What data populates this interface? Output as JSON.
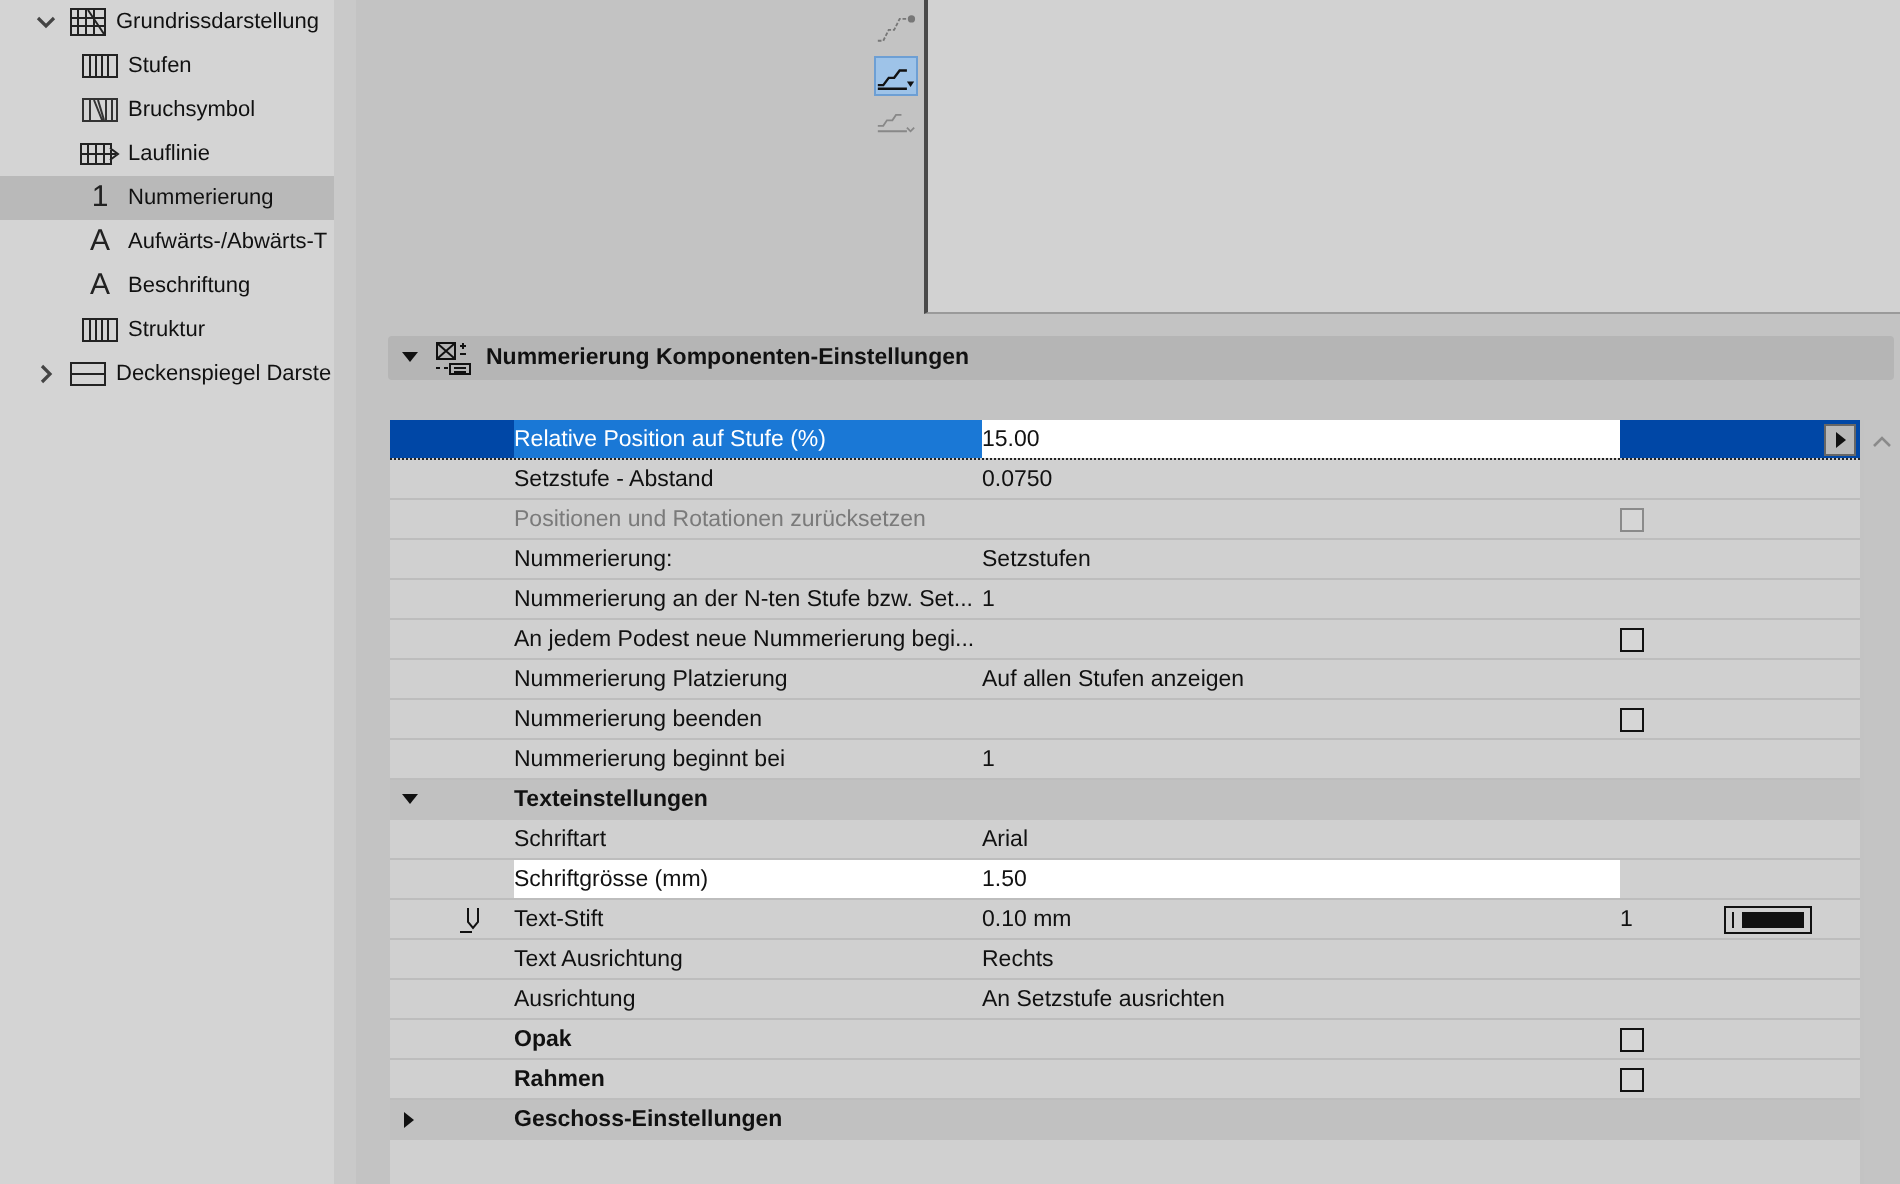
{
  "sidebar": {
    "items": [
      {
        "label": "Grundrissdarstellung",
        "kind": "plan",
        "expanded": true,
        "selected": false,
        "children": [
          {
            "label": "Stufen",
            "kind": "treads",
            "selected": false
          },
          {
            "label": "Bruchsymbol",
            "kind": "break",
            "selected": false
          },
          {
            "label": "Lauflinie",
            "kind": "walkline",
            "selected": false
          },
          {
            "label": "Nummerierung",
            "kind": "glyph",
            "glyph": "1",
            "selected": true
          },
          {
            "label": "Aufwärts-/Abwärts-T",
            "kind": "glyph",
            "glyph": "A",
            "selected": false
          },
          {
            "label": "Beschriftung",
            "kind": "glyph",
            "glyph": "A",
            "selected": false
          },
          {
            "label": "Struktur",
            "kind": "treads",
            "selected": false
          }
        ]
      },
      {
        "label": "Deckenspiegel Darste",
        "kind": "ceiling",
        "expanded": false,
        "selected": false
      }
    ]
  },
  "profile_buttons": [
    {
      "selected": false
    },
    {
      "selected": true
    },
    {
      "selected": false
    }
  ],
  "section": {
    "title": "Nummerierung Komponenten-Einstellungen",
    "expanded": true
  },
  "rows": [
    {
      "kind": "value",
      "label": "Relative Position auf Stufe (%)",
      "value": "15.00",
      "selected": true,
      "highlighted": true
    },
    {
      "kind": "value",
      "label": "Setzstufe - Abstand",
      "value": "0.0750",
      "selected": false,
      "highlighted": false
    },
    {
      "kind": "checkbox",
      "label": "Positionen und Rotationen zurücksetzen",
      "checked": false,
      "disabled": true,
      "selected": false
    },
    {
      "kind": "value",
      "label": "Nummerierung:",
      "value": "Setzstufen",
      "selected": false,
      "highlighted": false
    },
    {
      "kind": "value",
      "label": "Nummerierung an der N-ten Stufe bzw. Set...",
      "value": "1",
      "selected": false,
      "highlighted": false
    },
    {
      "kind": "checkbox",
      "label": "An jedem Podest neue Nummerierung begi...",
      "checked": false,
      "disabled": false,
      "selected": false
    },
    {
      "kind": "value",
      "label": "Nummerierung Platzierung",
      "value": "Auf allen Stufen anzeigen",
      "selected": false,
      "highlighted": false
    },
    {
      "kind": "checkbox",
      "label": "Nummerierung beenden",
      "checked": false,
      "disabled": false,
      "selected": false
    },
    {
      "kind": "value",
      "label": "Nummerierung beginnt bei",
      "value": "1",
      "selected": false,
      "highlighted": false
    },
    {
      "kind": "group",
      "label": "Texteinstellungen",
      "expanded": true
    },
    {
      "kind": "value",
      "label": "Schriftart",
      "value": "Arial",
      "selected": false,
      "highlighted": false
    },
    {
      "kind": "value",
      "label": "Schriftgrösse (mm)",
      "value": "1.50",
      "selected": false,
      "highlighted": true
    },
    {
      "kind": "pen",
      "label": "Text-Stift",
      "value": "0.10 mm",
      "pen": "1",
      "selected": false
    },
    {
      "kind": "value",
      "label": "Text Ausrichtung",
      "value": "Rechts",
      "selected": false,
      "highlighted": false
    },
    {
      "kind": "value",
      "label": "Ausrichtung",
      "value": "An Setzstufe ausrichten",
      "selected": false,
      "highlighted": false
    },
    {
      "kind": "checkbox",
      "label": "Opak",
      "bold": true,
      "checked": false,
      "disabled": false,
      "selected": false
    },
    {
      "kind": "checkbox",
      "label": "Rahmen",
      "bold": true,
      "checked": false,
      "disabled": false,
      "selected": false
    },
    {
      "kind": "group",
      "label": "Geschoss-Einstellungen",
      "expanded": false
    }
  ]
}
